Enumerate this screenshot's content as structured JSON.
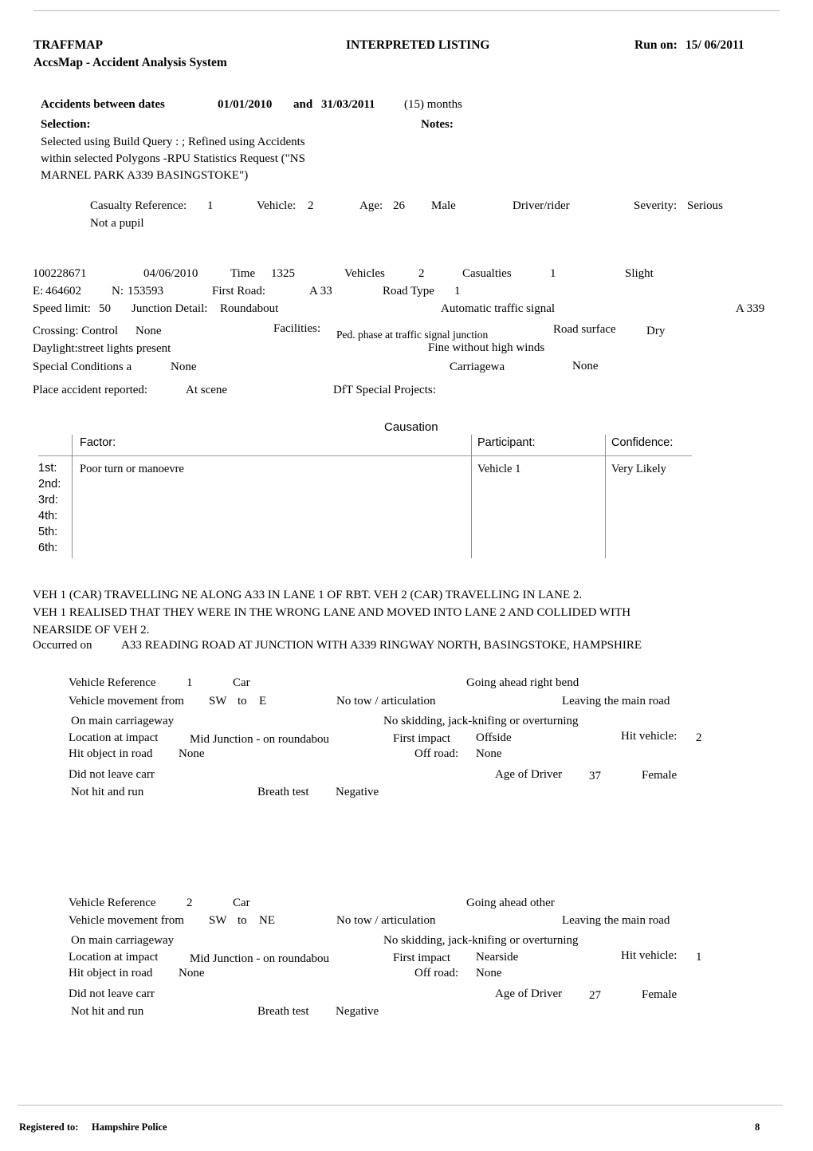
{
  "document": {
    "system_name": "TRAFFMAP",
    "subtitle": "AccsMap - Accident Analysis System",
    "report_title": "INTERPRETED LISTING",
    "run_on_label": "Run on:",
    "run_on_value": "15/ 06/2011"
  },
  "criteria": {
    "dates_label": "Accidents between dates",
    "date_from": "01/01/2010",
    "and_label": "and",
    "date_to": "31/03/2011",
    "months": "(15) months",
    "selection_label": "Selection:",
    "notes_label": "Notes:",
    "selection_lines": [
      "Selected using Build Query : ; Refined using Accidents",
      "within selected Polygons -RPU Statistics Request (\"NS",
      "MARNEL PARK A339 BASINGSTOKE\")"
    ]
  },
  "casualty": {
    "reference_label": "Casualty Reference:",
    "reference_value": "1",
    "vehicle_label": "Vehicle:",
    "vehicle_value": "2",
    "age_label": "Age:",
    "age_value": "26",
    "sex": "Male",
    "class": "Driver/rider",
    "severity_label": "Severity:",
    "severity_value": "Serious",
    "pupil": "Not a pupil"
  },
  "accident": {
    "reference": "100228671",
    "date": "04/06/2010",
    "time_label": "Time",
    "time_value": "1325",
    "vehicles_label": "Vehicles",
    "vehicles_value": "2",
    "casualties_label": "Casualties",
    "casualties_value": "1",
    "severity": "Slight",
    "easting_label": "E:",
    "easting_value": "464602",
    "northing_label": "N:",
    "northing_value": "153593",
    "first_road_label": "First Road:",
    "first_road_value": "A 33",
    "road_type_label": "Road Type",
    "road_type_value": "1",
    "speed_limit_label": "Speed limit:",
    "speed_limit_value": "50",
    "junction_detail_label": "Junction Detail:",
    "junction_detail_value": "Roundabout",
    "junction_control": "Automatic traffic signal",
    "second_road": "A 339",
    "crossing_control_label": "Crossing: Control",
    "crossing_control_value": "None",
    "facilities_label": "Facilities:",
    "facilities_value": "Ped. phase at traffic signal junction",
    "road_surface_label": "Road surface",
    "road_surface_value": "Dry",
    "light_conditions": "Daylight:street lights present",
    "weather": "Fine without high winds",
    "special_conditions_label": "Special Conditions a",
    "special_conditions_value": "None",
    "carriageway_label": "Carriagewa",
    "carriageway_value": "None",
    "place_reported_label": "Place accident reported:",
    "place_reported_value": "At scene",
    "dft_label": "DfT Special Projects:",
    "dft_value": ""
  },
  "causation": {
    "title": "Causation",
    "columns": {
      "factor": "Factor:",
      "participant": "Participant:",
      "confidence": "Confidence:"
    },
    "ordinals": [
      "1st:",
      "2nd:",
      "3rd:",
      "4th:",
      "5th:",
      "6th:"
    ],
    "rows": [
      {
        "factor": "Poor turn or manoevre",
        "participant": "Vehicle 1",
        "confidence": "Very Likely"
      },
      {
        "factor": "",
        "participant": "",
        "confidence": ""
      },
      {
        "factor": "",
        "participant": "",
        "confidence": ""
      },
      {
        "factor": "",
        "participant": "",
        "confidence": ""
      },
      {
        "factor": "",
        "participant": "",
        "confidence": ""
      },
      {
        "factor": "",
        "participant": "",
        "confidence": ""
      }
    ]
  },
  "narrative": {
    "lines": [
      "VEH 1 (CAR) TRAVELLING NE ALONG A33 IN LANE 1 OF RBT. VEH 2 (CAR) TRAVELLING IN LANE 2.",
      "VEH 1 REALISED THAT THEY WERE IN THE WRONG LANE AND MOVED INTO LANE 2 AND COLLIDED WITH",
      "NEARSIDE OF VEH 2."
    ],
    "occurred_on_label": "Occurred on",
    "occurred_on_value": "A33 READING ROAD AT JUNCTION WITH A339 RINGWAY NORTH, BASINGSTOKE, HAMPSHIRE"
  },
  "vehicles": [
    {
      "reference_label": "Vehicle Reference",
      "reference_value": "1",
      "type": "Car",
      "manoeuvre": "Going ahead right bend",
      "movement_label": "Vehicle movement from",
      "movement_from": "SW",
      "movement_to_label": "to",
      "movement_to": "E",
      "towing": "No tow / articulation",
      "junction_location": "Leaving the main road",
      "carriageway": "On main carriageway",
      "skidding": "No skidding, jack-knifing or overturning",
      "location_at_impact_label": "Location at impact",
      "location_at_impact_value": "Mid Junction - on roundabou",
      "first_impact_label": "First impact",
      "first_impact_value": "Offside",
      "hit_vehicle_label": "Hit vehicle:",
      "hit_vehicle_value": "2",
      "hit_object_label": "Hit object in road",
      "hit_object_value": "None",
      "off_road_label": "Off road:",
      "off_road_value": "None",
      "leaving_carriageway": "Did not leave carr",
      "age_of_driver_label": "Age of Driver",
      "age_of_driver_value": "37",
      "driver_sex": "Female",
      "hit_and_run": "Not hit and run",
      "breath_test_label": "Breath test",
      "breath_test_value": "Negative"
    },
    {
      "reference_label": "Vehicle Reference",
      "reference_value": "2",
      "type": "Car",
      "manoeuvre": "Going ahead other",
      "movement_label": "Vehicle movement from",
      "movement_from": "SW",
      "movement_to_label": "to",
      "movement_to": "NE",
      "towing": "No tow / articulation",
      "junction_location": "Leaving the main road",
      "carriageway": "On main carriageway",
      "skidding": "No skidding, jack-knifing or overturning",
      "location_at_impact_label": "Location at impact",
      "location_at_impact_value": "Mid Junction - on roundabou",
      "first_impact_label": "First impact",
      "first_impact_value": "Nearside",
      "hit_vehicle_label": "Hit vehicle:",
      "hit_vehicle_value": "1",
      "hit_object_label": "Hit object in road",
      "hit_object_value": "None",
      "off_road_label": "Off road:",
      "off_road_value": "None",
      "leaving_carriageway": "Did not leave carr",
      "age_of_driver_label": "Age of Driver",
      "age_of_driver_value": "27",
      "driver_sex": "Female",
      "hit_and_run": "Not hit and run",
      "breath_test_label": "Breath test",
      "breath_test_value": "Negative"
    }
  ],
  "footer": {
    "registered_label": "Registered to:",
    "registered_value": "Hampshire Police",
    "page_number": "8"
  }
}
